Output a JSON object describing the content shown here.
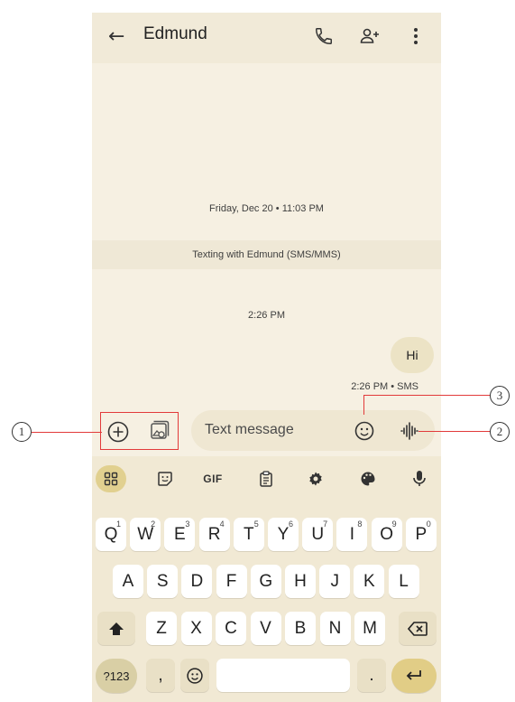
{
  "appbar": {
    "back_icon": "arrow-left-icon",
    "title": "Edmund",
    "icons": [
      "phone-icon",
      "add-person-icon",
      "more-vert-icon"
    ]
  },
  "chat": {
    "date_label": "Friday, Dec 20 • 11:03 PM",
    "banner": "Texting with Edmund (SMS/MMS)",
    "time_label": "2:26 PM",
    "message": "Hi",
    "message_meta": "2:26 PM • SMS"
  },
  "compose": {
    "placeholder": "Text message",
    "buttons": [
      "plus-circle-icon",
      "gallery-icon",
      "emoji-icon",
      "voice-waveform-icon"
    ]
  },
  "keyboard_toolbar": {
    "items": [
      "apps-grid-icon",
      "sticker-icon",
      "GIF",
      "clipboard-icon",
      "settings-icon",
      "palette-icon",
      "mic-icon"
    ]
  },
  "keyboard": {
    "row1": [
      {
        "key": "Q",
        "hint": "1"
      },
      {
        "key": "W",
        "hint": "2"
      },
      {
        "key": "E",
        "hint": "3"
      },
      {
        "key": "R",
        "hint": "4"
      },
      {
        "key": "T",
        "hint": "5"
      },
      {
        "key": "Y",
        "hint": "6"
      },
      {
        "key": "U",
        "hint": "7"
      },
      {
        "key": "I",
        "hint": "8"
      },
      {
        "key": "O",
        "hint": "9"
      },
      {
        "key": "P",
        "hint": "0"
      }
    ],
    "row2": [
      "A",
      "S",
      "D",
      "F",
      "G",
      "H",
      "J",
      "K",
      "L"
    ],
    "row3": [
      "Z",
      "X",
      "C",
      "V",
      "B",
      "N",
      "M"
    ],
    "sym_label": "?123",
    "comma": ",",
    "period": "."
  },
  "callouts": [
    "1",
    "2",
    "3"
  ],
  "colors": {
    "accent": "#e1cd86",
    "callout_line": "#e23a3a",
    "background": "#f6f0e2"
  }
}
